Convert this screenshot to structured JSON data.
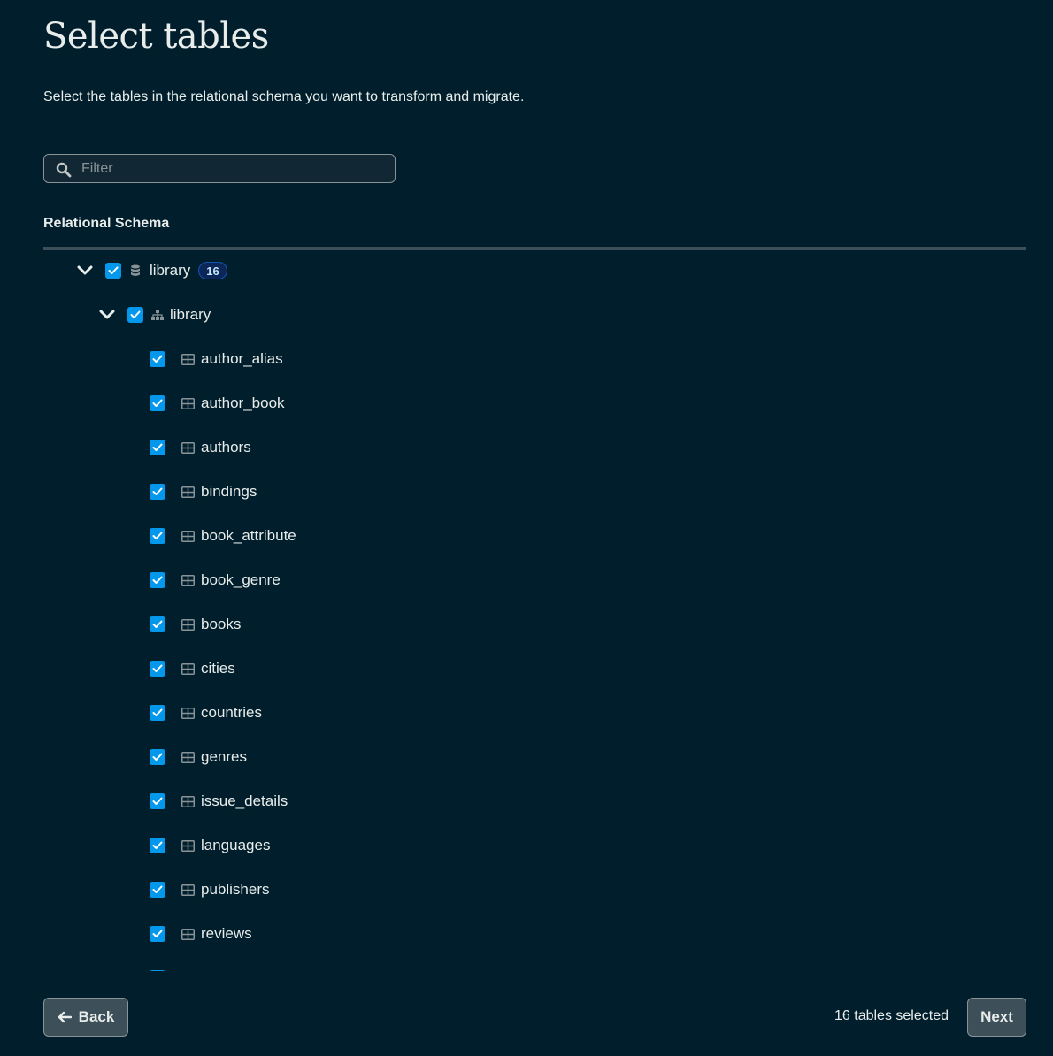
{
  "page": {
    "title": "Select tables",
    "subtitle": "Select the tables in the relational schema you want to transform and migrate."
  },
  "filter": {
    "placeholder": "Filter",
    "value": "",
    "icon": "search-icon"
  },
  "schema_section": {
    "label": "Relational Schema"
  },
  "tree": {
    "database": {
      "label": "library",
      "badge": "16",
      "icon": "database-icon",
      "expanded": true,
      "checked": true
    },
    "schema": {
      "label": "library",
      "icon": "schema-hierarchy-icon",
      "expanded": true,
      "checked": true
    },
    "tables": [
      {
        "label": "author_alias",
        "checked": true,
        "icon": "table-icon"
      },
      {
        "label": "author_book",
        "checked": true,
        "icon": "table-icon"
      },
      {
        "label": "authors",
        "checked": true,
        "icon": "table-icon"
      },
      {
        "label": "bindings",
        "checked": true,
        "icon": "table-icon"
      },
      {
        "label": "book_attribute",
        "checked": true,
        "icon": "table-icon"
      },
      {
        "label": "book_genre",
        "checked": true,
        "icon": "table-icon"
      },
      {
        "label": "books",
        "checked": true,
        "icon": "table-icon"
      },
      {
        "label": "cities",
        "checked": true,
        "icon": "table-icon"
      },
      {
        "label": "countries",
        "checked": true,
        "icon": "table-icon"
      },
      {
        "label": "genres",
        "checked": true,
        "icon": "table-icon"
      },
      {
        "label": "issue_details",
        "checked": true,
        "icon": "table-icon"
      },
      {
        "label": "languages",
        "checked": true,
        "icon": "table-icon"
      },
      {
        "label": "publishers",
        "checked": true,
        "icon": "table-icon"
      },
      {
        "label": "reviews",
        "checked": true,
        "icon": "table-icon"
      }
    ]
  },
  "footer": {
    "back_label": "Back",
    "next_label": "Next",
    "selected_text": "16 tables selected"
  },
  "colors": {
    "background": "#001e2b",
    "checkbox": "#0498ec",
    "badge_bg": "#0c2657",
    "button_bg": "#3d4f58"
  }
}
